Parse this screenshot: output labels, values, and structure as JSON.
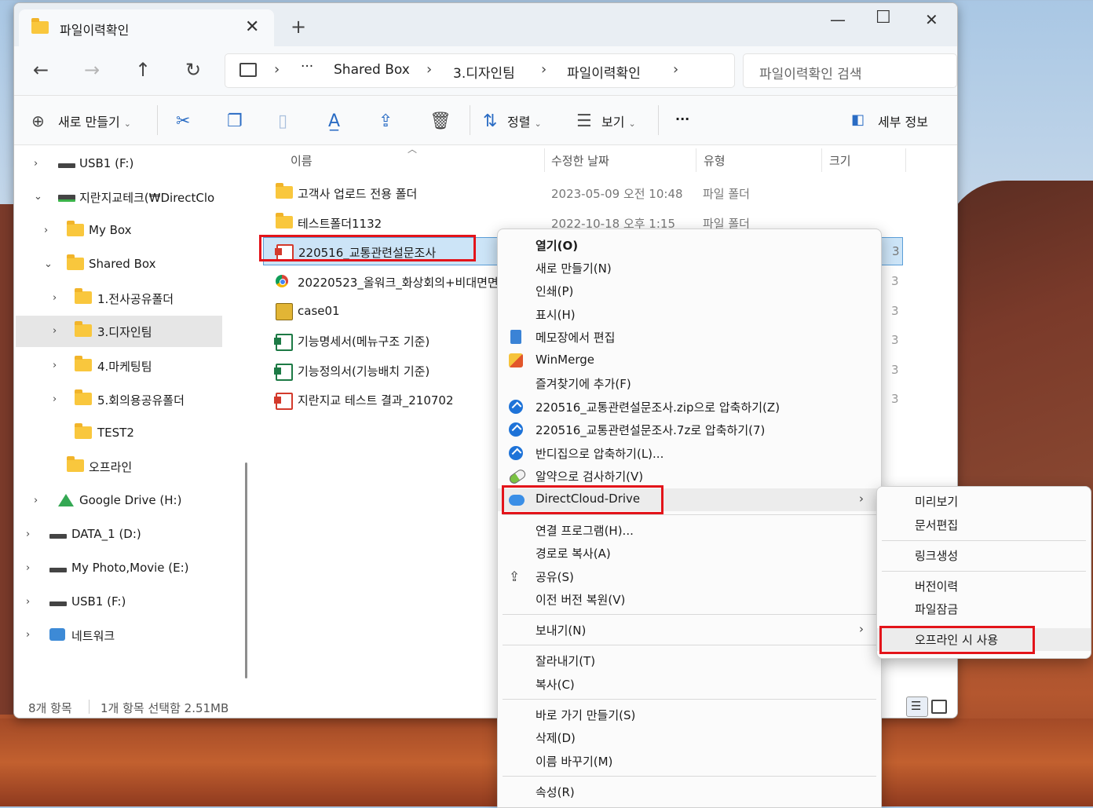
{
  "window": {
    "tab_title": "파일이력확인",
    "tab_close": "✕",
    "new_tab": "+",
    "minimize": "—",
    "maximize": "☐",
    "close": "✕"
  },
  "nav": {
    "back": "←",
    "forward": "→",
    "up": "↑",
    "refresh": "↻",
    "address": [
      "Shared Box",
      "3.디자인팀",
      "파일이력확인"
    ],
    "ellipsis": "···",
    "search_placeholder": "파일이력확인 검색"
  },
  "toolbar": {
    "new_label": "새로 만들기",
    "sort_label": "정렬",
    "view_label": "보기",
    "more_label": "···",
    "details_label": "세부 정보"
  },
  "sidebar": {
    "items": [
      {
        "label": "USB1 (F:)"
      },
      {
        "label": "지란지교테크(₩DirectClo"
      },
      {
        "label": "My Box"
      },
      {
        "label": "Shared Box"
      },
      {
        "label": "1.전사공유폴더"
      },
      {
        "label": "3.디자인팀"
      },
      {
        "label": "4.마케팅팀"
      },
      {
        "label": "5.회의용공유폴더"
      },
      {
        "label": "TEST2"
      },
      {
        "label": "오프라인"
      },
      {
        "label": "Google Drive (H:)"
      },
      {
        "label": "DATA_1 (D:)"
      },
      {
        "label": "My Photo,Movie (E:)"
      },
      {
        "label": "USB1 (F:)"
      },
      {
        "label": "네트워크"
      }
    ]
  },
  "columns": {
    "name": "이름",
    "date": "수정한 날짜",
    "type": "유형",
    "size": "크기"
  },
  "files": [
    {
      "name": "고객사 업로드 전용 폴더",
      "date": "2023-05-09 오전 10:48",
      "type": "파일 폴더"
    },
    {
      "name": "테스트폴더1132",
      "date": "2022-10-18 오후 1:15",
      "type": "파일 폴더"
    },
    {
      "name": "220516_교통관련설문조사",
      "date": "",
      "type": ""
    },
    {
      "name": "20220523_올워크_화상회의+비대면면",
      "date": "",
      "type": ""
    },
    {
      "name": "case01",
      "date": "",
      "type": ""
    },
    {
      "name": "기능명세서(메뉴구조 기준)",
      "date": "",
      "type": ""
    },
    {
      "name": "기능정의서(기능배치 기준)",
      "date": "",
      "type": ""
    },
    {
      "name": "지란지교 테스트 결과_210702",
      "date": "",
      "type": ""
    }
  ],
  "status": {
    "count": "8개 항목",
    "selected": "1개 항목 선택함 2.51MB"
  },
  "context_menu": {
    "items": [
      "열기(O)",
      "새로 만들기(N)",
      "인쇄(P)",
      "표시(H)",
      "메모장에서 편집",
      "WinMerge",
      "즐겨찾기에 추가(F)",
      "220516_교통관련설문조사.zip으로 압축하기(Z)",
      "220516_교통관련설문조사.7z로 압축하기(7)",
      "반디집으로 압축하기(L)...",
      "알약으로 검사하기(V)",
      "DirectCloud-Drive",
      "연결 프로그램(H)...",
      "경로로 복사(A)",
      "공유(S)",
      "이전 버전 복원(V)",
      "보내기(N)",
      "잘라내기(T)",
      "복사(C)",
      "바로 가기 만들기(S)",
      "삭제(D)",
      "이름 바꾸기(M)",
      "속성(R)"
    ],
    "arrow": "›"
  },
  "submenu": {
    "items": [
      "미리보기",
      "문서편집",
      "링크생성",
      "버전이력",
      "파일잠금",
      "오프라인 시 사용"
    ]
  }
}
